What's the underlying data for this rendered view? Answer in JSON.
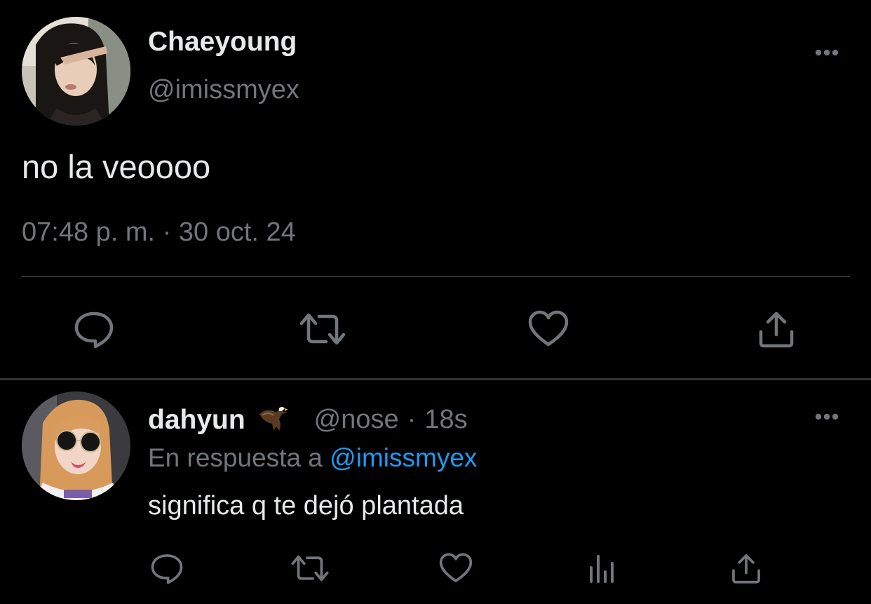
{
  "main_tweet": {
    "display_name": "Chaeyoung",
    "handle": "@imissmyex",
    "text": "no la veoooo",
    "timestamp": "07:48 p. m. · 30 oct. 24",
    "more_icon": "more-horizontal-icon",
    "actions": [
      "reply-icon",
      "retweet-icon",
      "like-icon",
      "share-icon"
    ]
  },
  "reply": {
    "display_name": "dahyun",
    "badge_icon": "eagle-emoji",
    "handle": "@nose",
    "separator": "·",
    "time": "18s",
    "reply_to_prefix": "En respuesta a",
    "reply_to_handle": "@imissmyex",
    "text": "significa q te dejó plantada",
    "more_icon": "more-horizontal-icon",
    "actions": [
      "reply-icon",
      "retweet-icon",
      "like-icon",
      "stats-icon",
      "share-icon"
    ]
  },
  "colors": {
    "background": "#000000",
    "primary_text": "#e7e9ea",
    "secondary_text": "#71767b",
    "link": "#1d9bf0",
    "divider": "#2f3336"
  }
}
